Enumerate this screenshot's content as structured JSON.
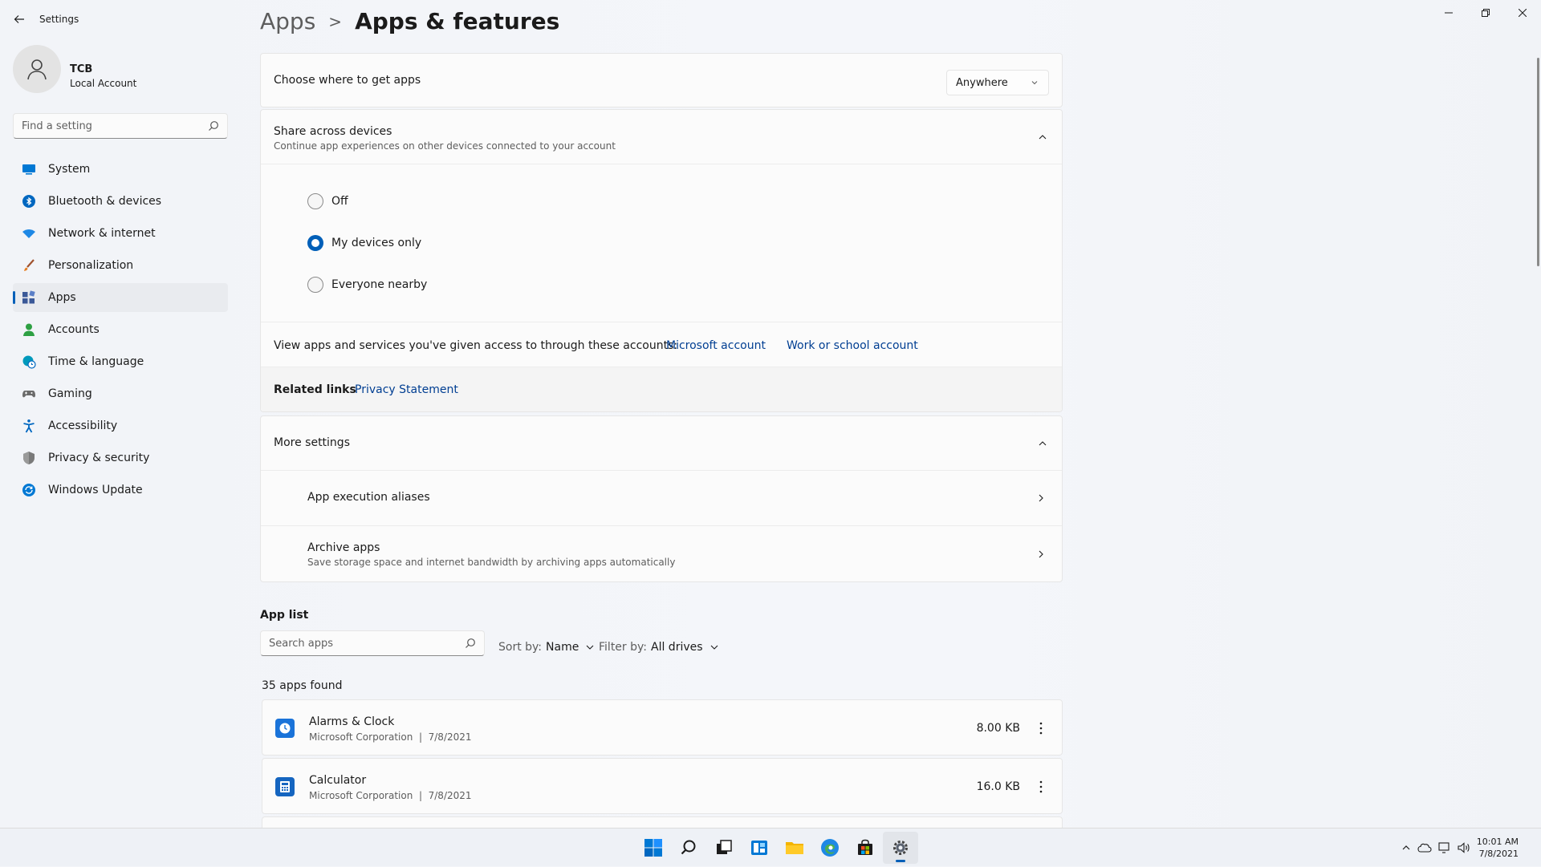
{
  "window": {
    "title": "Settings"
  },
  "profile": {
    "name": "TCB",
    "account_type": "Local Account"
  },
  "search": {
    "placeholder": "Find a setting"
  },
  "sidebar": {
    "items": [
      {
        "label": "System",
        "icon": "monitor-icon",
        "color": "#0078d4"
      },
      {
        "label": "Bluetooth & devices",
        "icon": "bluetooth-icon",
        "color": "#0067c0"
      },
      {
        "label": "Network & internet",
        "icon": "wifi-icon",
        "color": "#1e88e5"
      },
      {
        "label": "Personalization",
        "icon": "brush-icon",
        "color": "#e67e22"
      },
      {
        "label": "Apps",
        "icon": "apps-icon",
        "color": "#3b5998",
        "active": true
      },
      {
        "label": "Accounts",
        "icon": "person-icon",
        "color": "#2ea043"
      },
      {
        "label": "Time & language",
        "icon": "globe-clock-icon",
        "color": "#0099bc"
      },
      {
        "label": "Gaming",
        "icon": "gamepad-icon",
        "color": "#6b6b6b"
      },
      {
        "label": "Accessibility",
        "icon": "accessibility-icon",
        "color": "#0067c0"
      },
      {
        "label": "Privacy & security",
        "icon": "shield-icon",
        "color": "#6b6b6b"
      },
      {
        "label": "Windows Update",
        "icon": "update-icon",
        "color": "#0078d4"
      }
    ]
  },
  "breadcrumb": {
    "parent": "Apps",
    "separator": ">",
    "current": "Apps & features"
  },
  "choose_apps": {
    "label": "Choose where to get apps",
    "value": "Anywhere"
  },
  "share": {
    "title": "Share across devices",
    "subtitle": "Continue app experiences on other devices connected to your account",
    "options": [
      {
        "label": "Off",
        "checked": false
      },
      {
        "label": "My devices only",
        "checked": true
      },
      {
        "label": "Everyone nearby",
        "checked": false
      }
    ],
    "accounts_text": "View apps and services you've given access to through these accounts:",
    "microsoft_account": "Microsoft account",
    "work_account": "Work or school account"
  },
  "related": {
    "label": "Related links",
    "privacy": "Privacy Statement"
  },
  "more_settings": {
    "title": "More settings",
    "aliases": "App execution aliases",
    "archive_title": "Archive apps",
    "archive_sub": "Save storage space and internet bandwidth by archiving apps automatically"
  },
  "app_list": {
    "title": "App list",
    "search_placeholder": "Search apps",
    "sort_label": "Sort by:",
    "sort_value": "Name",
    "filter_label": "Filter by:",
    "filter_value": "All drives",
    "count": "35 apps found",
    "apps": [
      {
        "name": "Alarms & Clock",
        "publisher": "Microsoft Corporation",
        "date": "7/8/2021",
        "size": "8.00 KB"
      },
      {
        "name": "Calculator",
        "publisher": "Microsoft Corporation",
        "date": "7/8/2021",
        "size": "16.0 KB"
      }
    ]
  },
  "taskbar": {
    "time": "10:01 AM",
    "date": "7/8/2021"
  },
  "colors": {
    "accent": "#005fb8",
    "link": "#003e92"
  }
}
